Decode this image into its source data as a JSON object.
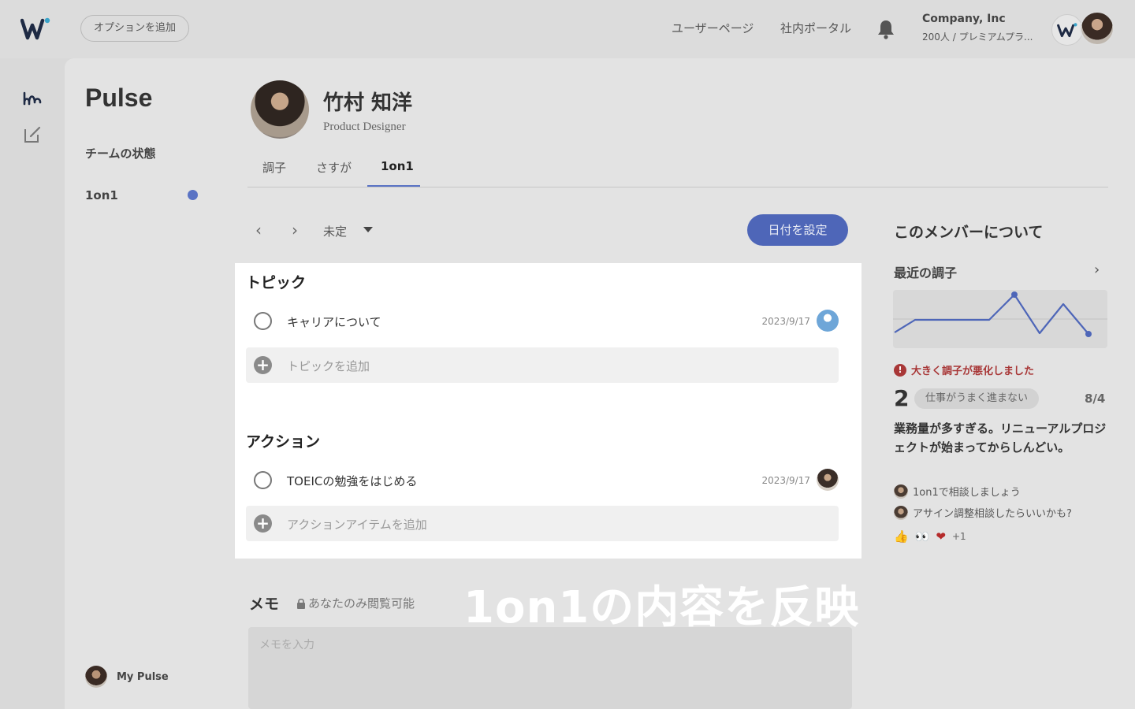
{
  "topbar": {
    "option_button": "オプションを追加",
    "nav_links": [
      "ユーザーページ",
      "社内ポータル"
    ],
    "company_name": "Company, Inc",
    "company_plan": "200人 / プレミアムプラ..."
  },
  "sidebar": {
    "title": "Pulse",
    "items": [
      {
        "label": "チームの状態"
      },
      {
        "label": "1on1"
      }
    ],
    "my_pulse": "My Pulse"
  },
  "profile": {
    "name": "竹村 知洋",
    "role": "Product Designer",
    "tabs": [
      "調子",
      "さすが",
      "1on1"
    ],
    "active_tab": "1on1"
  },
  "date_nav": {
    "date_label": "未定",
    "set_date_button": "日付を設定"
  },
  "topics": {
    "title": "トピック",
    "items": [
      {
        "label": "キャリアについて",
        "date": "2023/9/17"
      }
    ],
    "add_label": "トピックを追加"
  },
  "actions": {
    "title": "アクション",
    "items": [
      {
        "label": "TOEICの勉強をはじめる",
        "date": "2023/9/17"
      }
    ],
    "add_label": "アクションアイテムを追加"
  },
  "memo": {
    "title": "メモ",
    "visibility": "あなたのみ閲覧可能",
    "placeholder": "メモを入力"
  },
  "overlay_caption": "1on1の内容を反映",
  "about": {
    "title": "このメンバーについて",
    "recent_title": "最近の調子",
    "alert": "大きく調子が悪化しました",
    "score": "2",
    "reason": "仕事がうまく進まない",
    "score_date": "8/4",
    "comment": "業務量が多すぎる。リニューアルプロジェクトが始まってからしんどい。",
    "replies": [
      "1on1で相談しましょう",
      "アサイン調整相談したらいいかも?"
    ],
    "reactions": [
      "👍",
      "👀",
      "❤"
    ],
    "reaction_more": "+1"
  },
  "colors": {
    "accent": "#4e66b8",
    "alert": "#a83737"
  }
}
